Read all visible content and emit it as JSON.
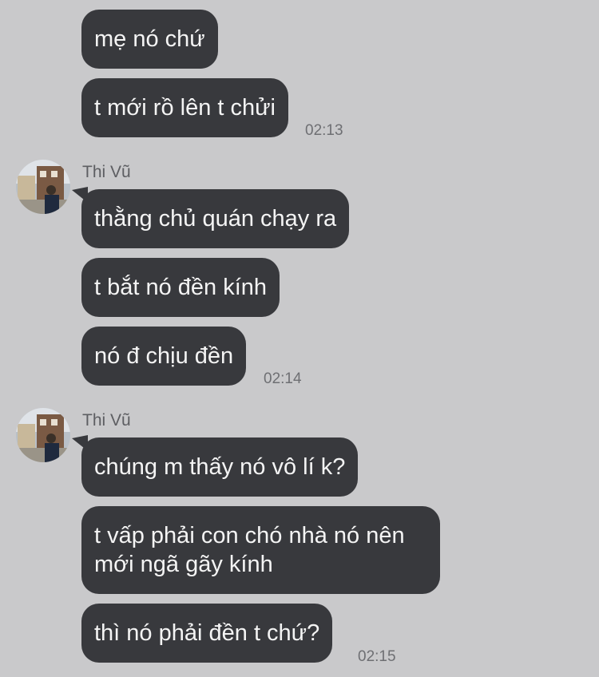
{
  "messages": [
    {
      "text": "mẹ nó chứ"
    },
    {
      "text": "t mới rồ lên t chửi"
    },
    {
      "text": "thằng chủ quán chạy ra"
    },
    {
      "text": "t bắt nó đền kính"
    },
    {
      "text": "nó đ chịu đền"
    },
    {
      "text": "chúng m thấy nó vô lí k?"
    },
    {
      "text": "t vấp phải con chó nhà nó nên mới ngã gãy kính"
    },
    {
      "text": "thì nó phải đền t chứ?"
    }
  ],
  "times": [
    "02:13",
    "02:14",
    "02:15"
  ],
  "sender": {
    "name": "Thi Vũ"
  },
  "colors": {
    "background": "#c9c9cb",
    "bubble": "#38393d",
    "bubble_text": "#f4f4f4",
    "time": "#6e6f73"
  }
}
